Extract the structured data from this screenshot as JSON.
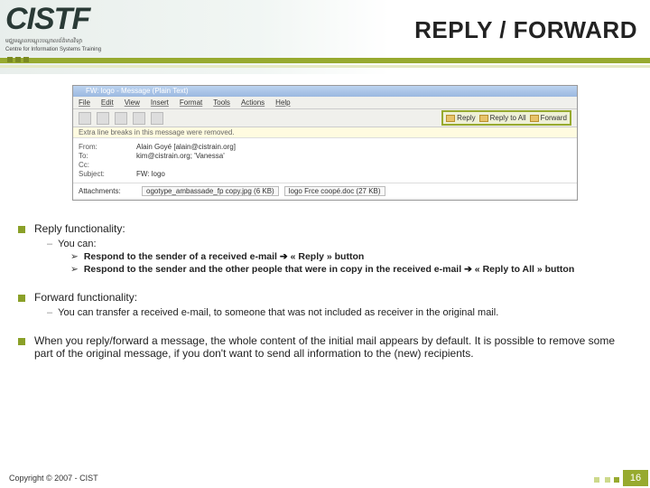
{
  "header": {
    "logo_text": "CISTF",
    "logo_sub1": "មជ្ឈមណ្ឌលបណ្តុះបណ្តាលព័ត៌មានវិទ្យា",
    "logo_sub2": "Centre for Information Systems Training",
    "title": "REPLY / FORWARD"
  },
  "screenshot": {
    "window_title": "FW: logo - Message (Plain Text)",
    "menus": [
      "File",
      "Edit",
      "View",
      "Insert",
      "Format",
      "Tools",
      "Actions",
      "Help"
    ],
    "reply_btn": "Reply",
    "reply_all_btn": "Reply to All",
    "forward_btn": "Forward",
    "infobar": "Extra line breaks in this message were removed.",
    "from_label": "From:",
    "from_value": "Alain Goyé [alain@cistrain.org]",
    "to_label": "To:",
    "to_value": "kim@cistrain.org; 'Vanessa'",
    "cc_label": "Cc:",
    "subject_label": "Subject:",
    "subject_value": "FW: logo",
    "attach_label": "Attachments:",
    "attach1": "ogotype_ambassade_fp copy.jpg (6 KB)",
    "attach2": "logo Frce coopé.doc (27 KB)"
  },
  "bullets": {
    "b1": "Reply functionality:",
    "b1s1": "You can:",
    "b1s1a_pre": "Respond to the sender of a received e-mail ",
    "b1s1a_post": " « Reply » button",
    "b1s1b_pre": "Respond to the sender and the other people that were in copy in the received e-mail ",
    "b1s1b_post": " « Reply to All » button",
    "b2": "Forward functionality:",
    "b2s1": "You can transfer a received e-mail, to someone that was not included as receiver in the original mail.",
    "b3": "When you reply/forward a message, the whole content of the initial mail appears by default. It is possible to remove some part of the original message, if you don't want to send all information to the (new) recipients."
  },
  "footer": {
    "copyright": "Copyright © 2007 - CIST",
    "page": "16"
  }
}
